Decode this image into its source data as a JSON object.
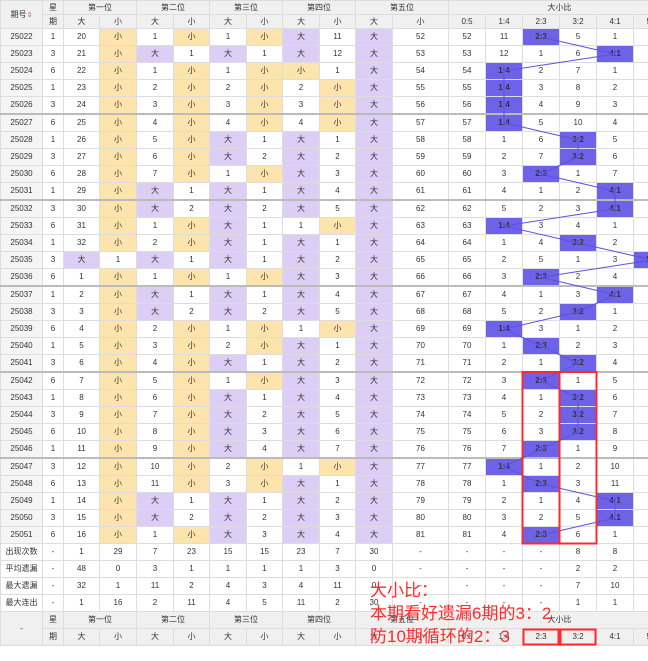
{
  "labels": {
    "period": "期号",
    "sort_icon": "⇕",
    "weekday_top": "星",
    "weekday_bottom": "期",
    "pos": [
      "第一位",
      "第二位",
      "第三位",
      "第四位",
      "第五位"
    ],
    "big": "大",
    "small": "小",
    "ratio": "大小比",
    "ratio_cols": [
      "0:5",
      "1:4",
      "2:3",
      "3:2",
      "4:1",
      "5:0"
    ],
    "bottom_dash": "-"
  },
  "colors": {
    "big_bg": "#dccef5",
    "small_bg": "#fde4ad",
    "ratio_bg": "#6e63e8",
    "line": "#5a52e0",
    "highlight": "#ff2a2a"
  },
  "rows": [
    [
      "25022",
      "1",
      "20",
      "小",
      "1",
      "小",
      "1",
      "小",
      "大",
      "11",
      "大",
      "52",
      "52",
      "11",
      "2:3",
      "5",
      "1",
      "20"
    ],
    [
      "25023",
      "3",
      "21",
      "小",
      "大",
      "1",
      "大",
      "1",
      "大",
      "12",
      "大",
      "53",
      "53",
      "12",
      "1",
      "6",
      "4:1",
      "21"
    ],
    [
      "25024",
      "6",
      "22",
      "小",
      "1",
      "小",
      "1",
      "小",
      "小",
      "1",
      "大",
      "54",
      "54",
      "1:4",
      "2",
      "7",
      "1",
      "22"
    ],
    [
      "25025",
      "1",
      "23",
      "小",
      "2",
      "小",
      "2",
      "小",
      "2",
      "小",
      "大",
      "55",
      "55",
      "1:4",
      "3",
      "8",
      "2",
      "23"
    ],
    [
      "25026",
      "3",
      "24",
      "小",
      "3",
      "小",
      "3",
      "小",
      "3",
      "小",
      "大",
      "56",
      "56",
      "1:4",
      "4",
      "9",
      "3",
      "24"
    ],
    [
      "25027",
      "6",
      "25",
      "小",
      "4",
      "小",
      "4",
      "小",
      "4",
      "小",
      "大",
      "57",
      "57",
      "1:4",
      "5",
      "10",
      "4",
      "25"
    ],
    [
      "25028",
      "1",
      "26",
      "小",
      "5",
      "小",
      "大",
      "1",
      "大",
      "1",
      "大",
      "58",
      "58",
      "1",
      "6",
      "3:2",
      "5",
      "26"
    ],
    [
      "25029",
      "3",
      "27",
      "小",
      "6",
      "小",
      "大",
      "2",
      "大",
      "2",
      "大",
      "59",
      "59",
      "2",
      "7",
      "3:2",
      "6",
      "27"
    ],
    [
      "25030",
      "6",
      "28",
      "小",
      "7",
      "小",
      "1",
      "小",
      "大",
      "3",
      "大",
      "60",
      "60",
      "3",
      "2:3",
      "1",
      "7",
      "28"
    ],
    [
      "25031",
      "1",
      "29",
      "小",
      "大",
      "1",
      "大",
      "1",
      "大",
      "4",
      "大",
      "61",
      "61",
      "4",
      "1",
      "2",
      "4:1",
      "29"
    ],
    [
      "25032",
      "3",
      "30",
      "小",
      "大",
      "2",
      "大",
      "2",
      "大",
      "5",
      "大",
      "62",
      "62",
      "5",
      "2",
      "3",
      "4:1",
      "30"
    ],
    [
      "25033",
      "6",
      "31",
      "小",
      "1",
      "小",
      "大",
      "1",
      "1",
      "小",
      "大",
      "63",
      "63",
      "1:4",
      "3",
      "4",
      "1",
      "31"
    ],
    [
      "25034",
      "1",
      "32",
      "小",
      "2",
      "小",
      "大",
      "1",
      "大",
      "1",
      "大",
      "64",
      "64",
      "1",
      "4",
      "3:2",
      "2",
      "32"
    ],
    [
      "25035",
      "3",
      "大",
      "1",
      "大",
      "1",
      "大",
      "1",
      "大",
      "2",
      "大",
      "65",
      "65",
      "2",
      "5",
      "1",
      "3",
      "5:0"
    ],
    [
      "25036",
      "6",
      "1",
      "小",
      "1",
      "小",
      "1",
      "小",
      "大",
      "3",
      "大",
      "66",
      "66",
      "3",
      "2:3",
      "2",
      "4",
      "1"
    ],
    [
      "25037",
      "1",
      "2",
      "小",
      "大",
      "1",
      "大",
      "1",
      "大",
      "4",
      "大",
      "67",
      "67",
      "4",
      "1",
      "3",
      "4:1",
      "2"
    ],
    [
      "25038",
      "3",
      "3",
      "小",
      "大",
      "2",
      "大",
      "2",
      "大",
      "5",
      "大",
      "68",
      "68",
      "5",
      "2",
      "3:2",
      "1",
      "3"
    ],
    [
      "25039",
      "6",
      "4",
      "小",
      "2",
      "小",
      "1",
      "小",
      "1",
      "小",
      "大",
      "69",
      "69",
      "1:4",
      "3",
      "1",
      "2",
      "4"
    ],
    [
      "25040",
      "1",
      "5",
      "小",
      "3",
      "小",
      "2",
      "小",
      "大",
      "1",
      "大",
      "70",
      "70",
      "1",
      "2:3",
      "2",
      "3",
      "5"
    ],
    [
      "25041",
      "3",
      "6",
      "小",
      "4",
      "小",
      "大",
      "1",
      "大",
      "2",
      "大",
      "71",
      "71",
      "2",
      "1",
      "3:2",
      "4",
      "6"
    ],
    [
      "25042",
      "6",
      "7",
      "小",
      "5",
      "小",
      "1",
      "小",
      "大",
      "3",
      "大",
      "72",
      "72",
      "3",
      "2:3",
      "1",
      "5",
      "7"
    ],
    [
      "25043",
      "1",
      "8",
      "小",
      "6",
      "小",
      "大",
      "1",
      "大",
      "4",
      "大",
      "73",
      "73",
      "4",
      "1",
      "3:2",
      "6",
      "8"
    ],
    [
      "25044",
      "3",
      "9",
      "小",
      "7",
      "小",
      "大",
      "2",
      "大",
      "5",
      "大",
      "74",
      "74",
      "5",
      "2",
      "3:2",
      "7",
      "9"
    ],
    [
      "25045",
      "6",
      "10",
      "小",
      "8",
      "小",
      "大",
      "3",
      "大",
      "6",
      "大",
      "75",
      "75",
      "6",
      "3",
      "3:2",
      "8",
      "10"
    ],
    [
      "25046",
      "1",
      "11",
      "小",
      "9",
      "小",
      "大",
      "4",
      "大",
      "7",
      "大",
      "76",
      "76",
      "7",
      "2:3",
      "1",
      "9",
      "11"
    ],
    [
      "25047",
      "3",
      "12",
      "小",
      "10",
      "小",
      "2",
      "小",
      "1",
      "小",
      "大",
      "77",
      "77",
      "1:4",
      "1",
      "2",
      "10",
      "12"
    ],
    [
      "25048",
      "6",
      "13",
      "小",
      "11",
      "小",
      "3",
      "小",
      "大",
      "1",
      "大",
      "78",
      "78",
      "1",
      "2:3",
      "3",
      "11",
      "13"
    ],
    [
      "25049",
      "1",
      "14",
      "小",
      "大",
      "1",
      "大",
      "1",
      "大",
      "2",
      "大",
      "79",
      "79",
      "2",
      "1",
      "4",
      "4:1",
      "14"
    ],
    [
      "25050",
      "3",
      "15",
      "小",
      "大",
      "2",
      "大",
      "2",
      "大",
      "3",
      "大",
      "80",
      "80",
      "3",
      "2",
      "5",
      "4:1",
      "15"
    ],
    [
      "25051",
      "6",
      "16",
      "小",
      "1",
      "小",
      "大",
      "3",
      "大",
      "4",
      "大",
      "81",
      "81",
      "4",
      "2:3",
      "6",
      "1",
      "16"
    ]
  ],
  "stats": [
    {
      "label": "出现次数",
      "cls": "sl1",
      "values": [
        "-",
        "1",
        "29",
        "7",
        "23",
        "15",
        "15",
        "23",
        "7",
        "30",
        "-",
        "-",
        "-",
        "-",
        "8",
        "8",
        "6",
        "1"
      ]
    },
    {
      "label": "平均遗漏",
      "cls": "sl2",
      "values": [
        "-",
        "48",
        "0",
        "3",
        "1",
        "1",
        "1",
        "1",
        "3",
        "0",
        "-",
        "-",
        "-",
        "-",
        "2",
        "2",
        "4",
        "48"
      ]
    },
    {
      "label": "最大遗漏",
      "cls": "sl2",
      "values": [
        "-",
        "32",
        "1",
        "11",
        "2",
        "4",
        "3",
        "4",
        "11",
        "0",
        "-",
        "-",
        "-",
        "-",
        "7",
        "10",
        "11",
        "32"
      ]
    },
    {
      "label": "最大连出",
      "cls": "sl1",
      "values": [
        "-",
        "1",
        "16",
        "2",
        "11",
        "4",
        "5",
        "11",
        "2",
        "30",
        "-",
        "-",
        "-",
        "-",
        "1",
        "1",
        "2",
        "1"
      ]
    }
  ],
  "note": {
    "line1": "大小比：",
    "line2": "本期看好遗漏6期的3：2",
    "line3": "防10期循环的2：3"
  }
}
